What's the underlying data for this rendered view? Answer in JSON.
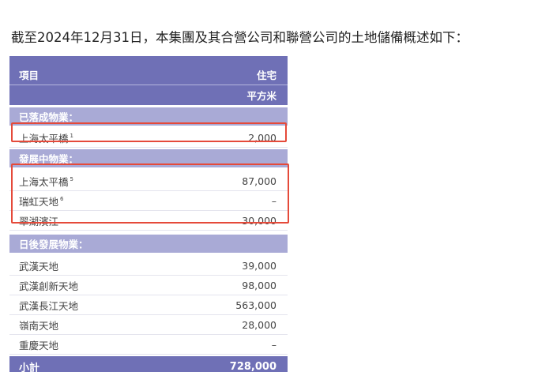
{
  "intro_text": "截至2024年12月31日，本集團及其合營公司和聯營公司的土地儲備概述如下：",
  "table": {
    "header": {
      "col1": "項目",
      "col2": "住宅",
      "unit": "平方米"
    },
    "sections": [
      {
        "title": "已落成物業：",
        "rows": [
          {
            "name": "上海太平橋",
            "note": "1",
            "value": "2,000"
          }
        ]
      },
      {
        "title": "發展中物業：",
        "rows": [
          {
            "name": "上海太平橋",
            "note": "5",
            "value": "87,000"
          },
          {
            "name": "瑞虹天地",
            "note": "6",
            "value": "–"
          },
          {
            "name": "翠湖濱江",
            "note": "",
            "value": "30,000"
          }
        ]
      },
      {
        "title": "日後發展物業：",
        "rows": [
          {
            "name": "武漢天地",
            "note": "",
            "value": "39,000"
          },
          {
            "name": "武漢創新天地",
            "note": "",
            "value": "98,000"
          },
          {
            "name": "武漢長江天地",
            "note": "",
            "value": "563,000"
          },
          {
            "name": "嶺南天地",
            "note": "",
            "value": "28,000"
          },
          {
            "name": "重慶天地",
            "note": "",
            "value": "–"
          }
        ]
      }
    ],
    "total": {
      "label": "小計",
      "value": "728,000"
    }
  },
  "highlight_color": "#e54a3a"
}
